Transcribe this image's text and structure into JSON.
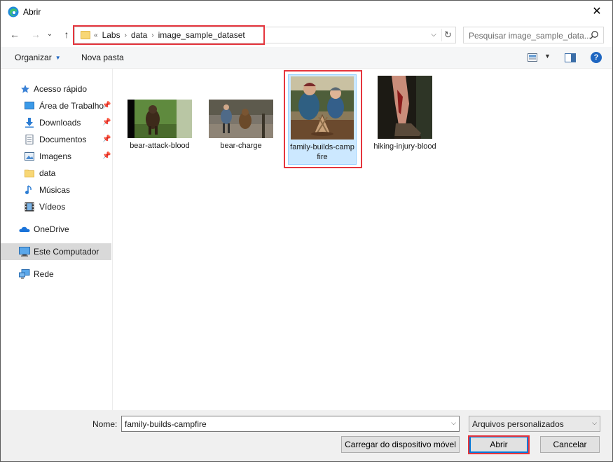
{
  "window": {
    "title": "Abrir",
    "close_glyph": "✕"
  },
  "nav": {
    "back_glyph": "←",
    "forward_glyph": "→",
    "recent_glyph": "⌄",
    "up_glyph": "↑",
    "address": {
      "overflow": "«",
      "crumbs": [
        "Labs",
        "data",
        "image_sample_dataset"
      ],
      "separator": "›",
      "dropdown_glyph": "⌵",
      "refresh_glyph": "↻"
    },
    "search": {
      "placeholder": "Pesquisar image_sample_data..."
    }
  },
  "toolbar": {
    "organize_label": "Organizar",
    "organize_arrow": "▼",
    "new_folder_label": "Nova pasta",
    "view_arrow": "▼",
    "help_glyph": "?"
  },
  "sidebar": {
    "items": [
      {
        "label": "Acesso rápido",
        "icon": "star-icon"
      },
      {
        "label": "Área de Trabalho",
        "icon": "desktop-icon",
        "pinned": true
      },
      {
        "label": "Downloads",
        "icon": "download-icon",
        "pinned": true
      },
      {
        "label": "Documentos",
        "icon": "document-icon",
        "pinned": true
      },
      {
        "label": "Imagens",
        "icon": "pictures-icon",
        "pinned": true
      },
      {
        "label": "data",
        "icon": "folder-icon"
      },
      {
        "label": "Músicas",
        "icon": "music-icon"
      },
      {
        "label": "Vídeos",
        "icon": "video-icon"
      },
      {
        "label": "OneDrive",
        "icon": "cloud-icon"
      },
      {
        "label": "Este Computador",
        "icon": "computer-icon",
        "selected": true
      },
      {
        "label": "Rede",
        "icon": "network-icon"
      }
    ],
    "pin_glyph": "📌"
  },
  "files": [
    {
      "label": "bear-attack-blood"
    },
    {
      "label": "bear-charge"
    },
    {
      "label": "family-builds-campfire",
      "selected": true
    },
    {
      "label": "hiking-injury-blood"
    }
  ],
  "footer": {
    "name_label": "Nome:",
    "name_value": "family-builds-campfire",
    "filter_value": "Arquivos personalizados",
    "dropdown_glyph": "⌵",
    "mobile_button": "Carregar do dispositivo móvel",
    "open_button": "Abrir",
    "cancel_button": "Cancelar"
  },
  "colors": {
    "highlight": "#e5353d",
    "selection": "#cce8ff",
    "accent": "#0078d7"
  }
}
